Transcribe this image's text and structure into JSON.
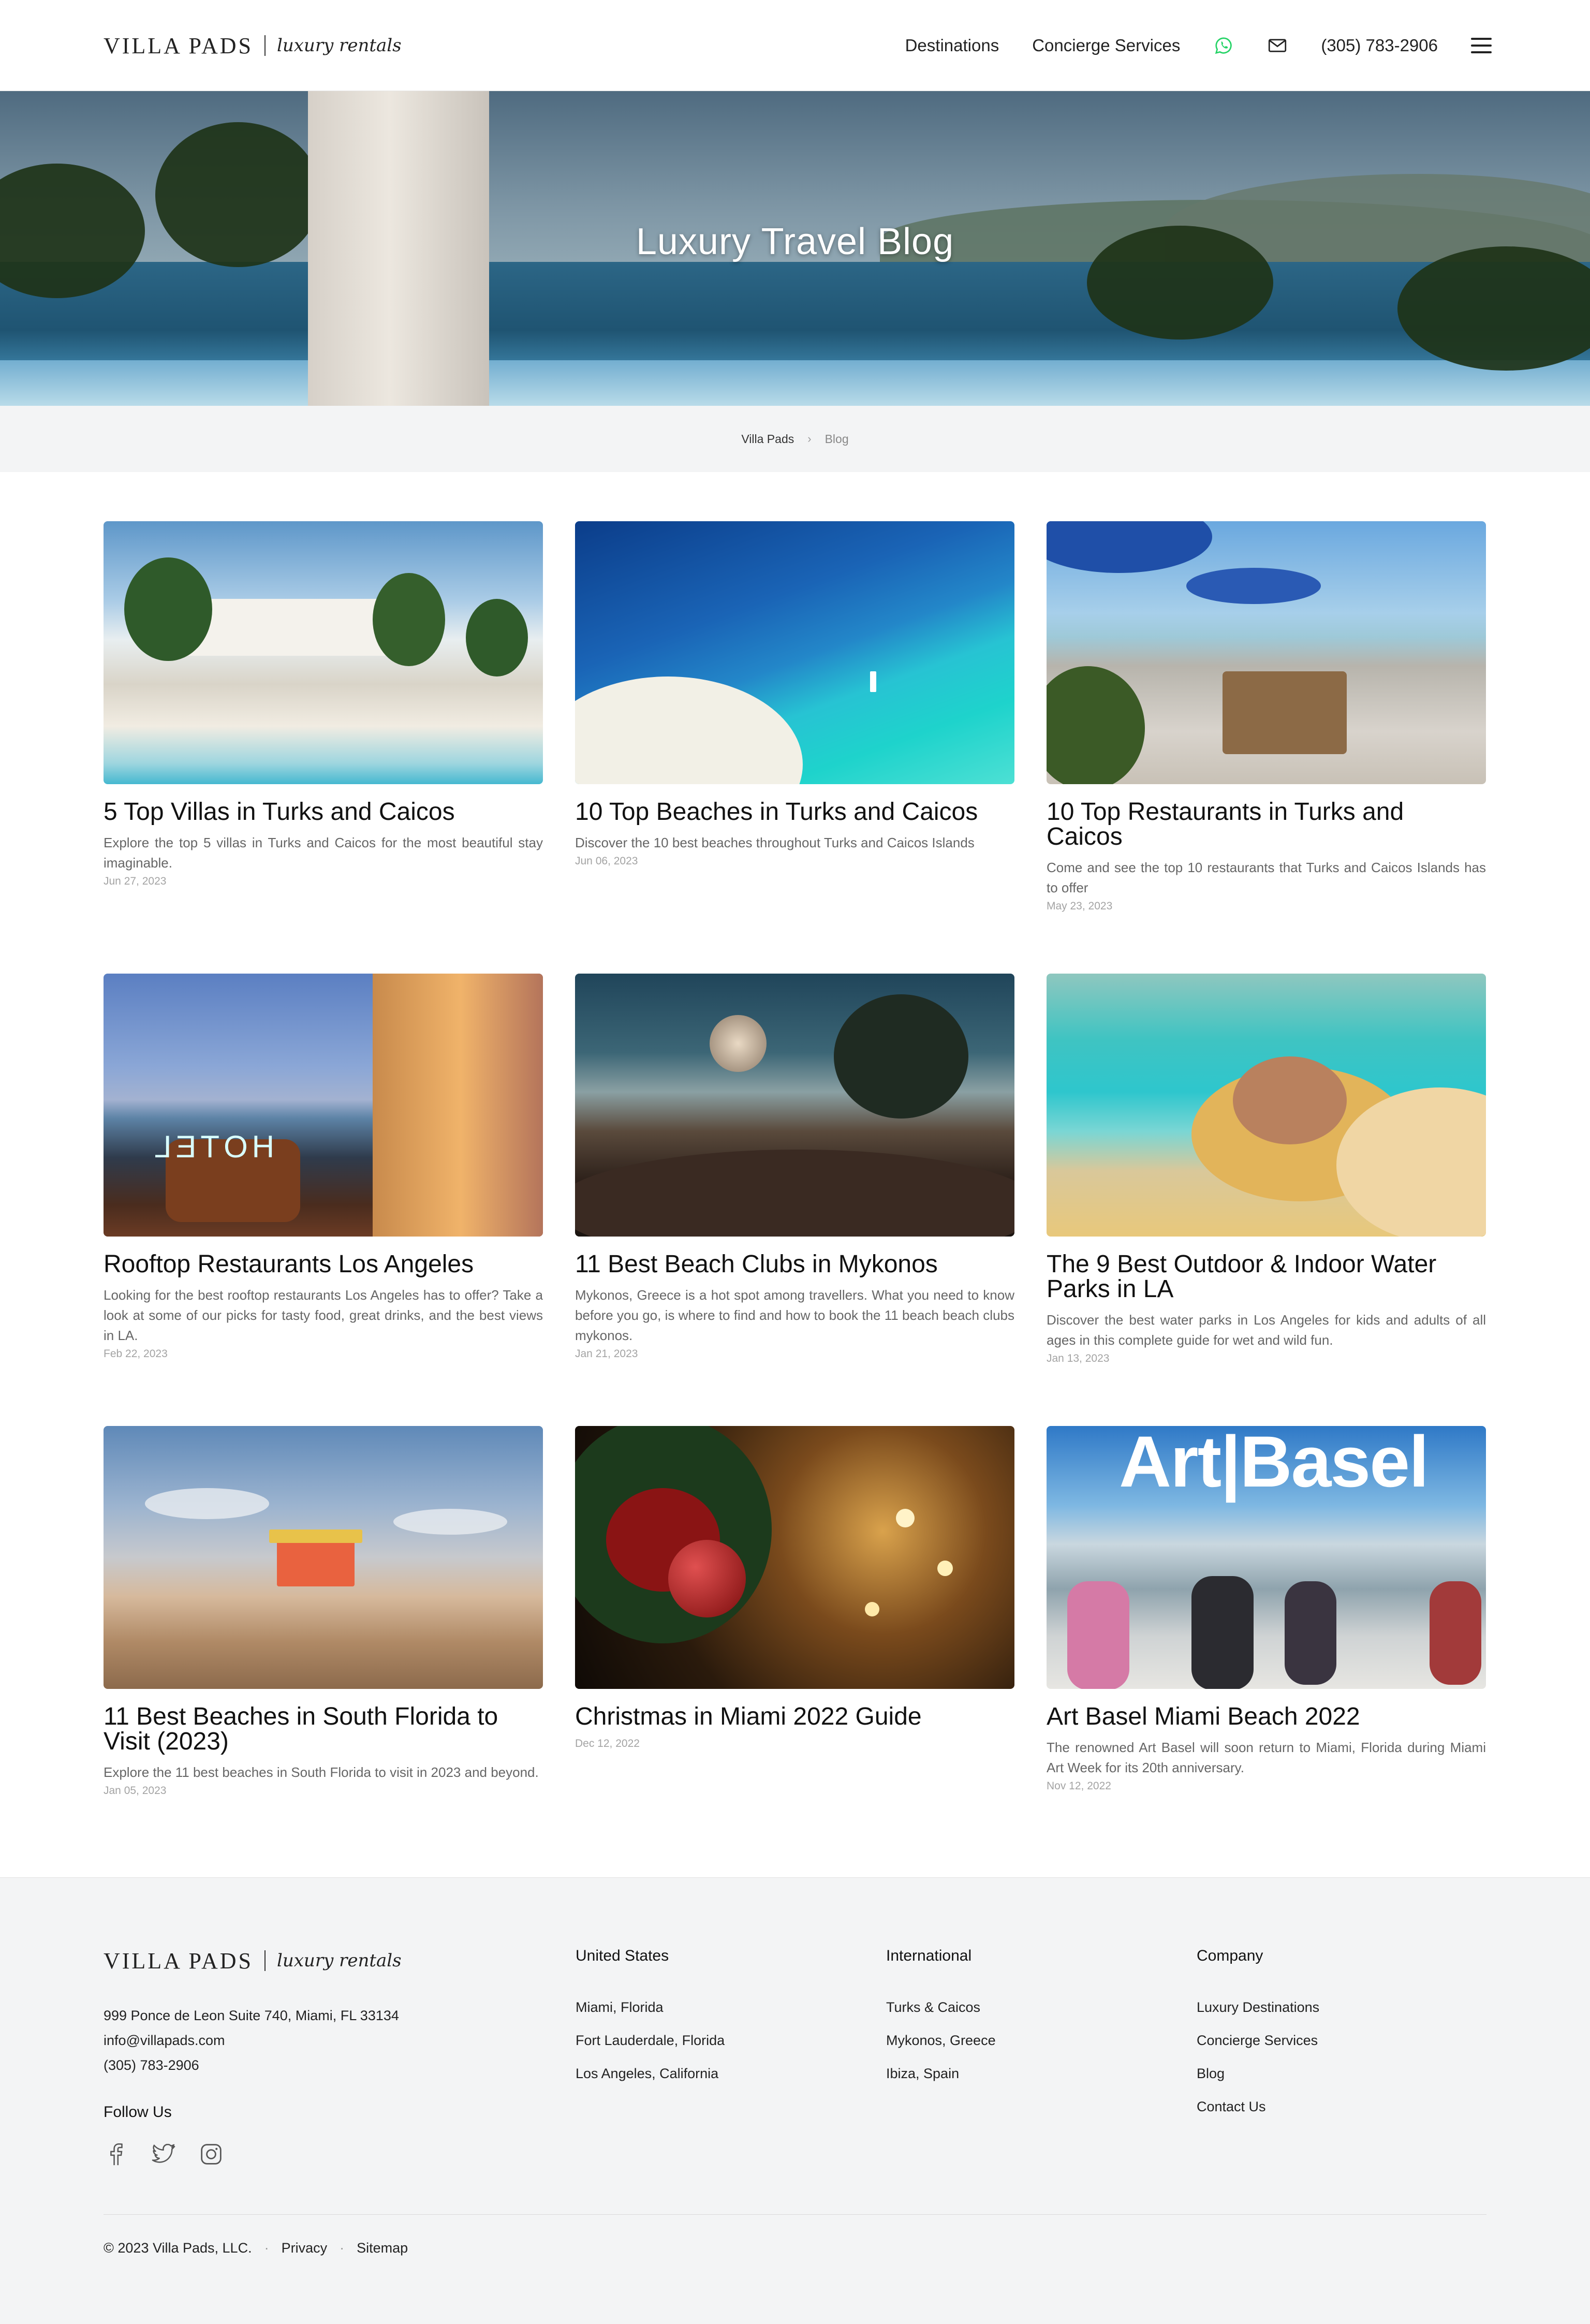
{
  "header": {
    "logo_main": "VILLA PADS",
    "logo_script": "luxury rentals",
    "nav": [
      "Destinations",
      "Concierge Services"
    ],
    "phone": "(305) 783-2906",
    "icons": [
      "whatsapp-icon",
      "mail-icon",
      "menu-icon"
    ]
  },
  "hero": {
    "title": "Luxury Travel Blog"
  },
  "breadcrumb": {
    "home": "Villa Pads",
    "current": "Blog"
  },
  "posts": [
    {
      "title": "5 Top Villas in Turks and Caicos",
      "excerpt": "Explore the top 5 villas in Turks and Caicos for the most beautiful stay imaginable.",
      "date": "Jun 27, 2023"
    },
    {
      "title": "10 Top Beaches in Turks and Caicos",
      "excerpt": "Discover the 10 best beaches throughout Turks and Caicos Islands",
      "date": "Jun 06, 2023"
    },
    {
      "title": "10 Top Restaurants in Turks and Caicos",
      "excerpt": "Come and see the top 10 restaurants that Turks and Caicos Islands has to offer",
      "date": "May 23, 2023"
    },
    {
      "title": "Rooftop Restaurants Los Angeles",
      "excerpt": "Looking for the best rooftop restaurants Los Angeles has to offer? Take a look at some of our picks for tasty food, great drinks, and the best views in LA.",
      "date": "Feb 22, 2023"
    },
    {
      "title": "11 Best Beach Clubs in Mykonos",
      "excerpt": "Mykonos, Greece is a hot spot among travellers. What you need to know before you go, is where to find and how to book the 11 beach beach clubs mykonos.",
      "date": "Jan 21, 2023"
    },
    {
      "title": "The 9 Best Outdoor & Indoor Water Parks in LA",
      "excerpt": "Discover the best water parks in Los Angeles for kids and adults of all ages in this complete guide for wet and wild fun.",
      "date": "Jan 13, 2023"
    },
    {
      "title": "11 Best Beaches in South Florida to Visit (2023)",
      "excerpt": "Explore the 11 best beaches in South Florida to visit in 2023 and beyond.",
      "date": "Jan 05, 2023"
    },
    {
      "title": "Christmas in Miami 2022 Guide",
      "excerpt": "",
      "date": "Dec 12, 2022"
    },
    {
      "title": "Art Basel Miami Beach 2022",
      "excerpt": "The renowned Art Basel will soon return to Miami, Florida during Miami Art Week for its 20th anniversary.",
      "date": "Nov 12, 2022"
    }
  ],
  "images": {
    "rooftop_sign": "HOTEL",
    "basel_sign": "Art|Basel"
  },
  "footer": {
    "logo_main": "VILLA PADS",
    "logo_script": "luxury rentals",
    "address": "999 Ponce de Leon Suite 740, Miami, FL 33134",
    "email": "info@villapads.com",
    "phone": "(305) 783-2906",
    "follow": "Follow Us",
    "social": [
      "facebook-icon",
      "twitter-icon",
      "instagram-icon"
    ],
    "columns": [
      {
        "heading": "United States",
        "links": [
          "Miami, Florida",
          "Fort Lauderdale, Florida",
          "Los Angeles, California"
        ]
      },
      {
        "heading": "International",
        "links": [
          "Turks & Caicos",
          "Mykonos, Greece",
          "Ibiza, Spain"
        ]
      },
      {
        "heading": "Company",
        "links": [
          "Luxury Destinations",
          "Concierge Services",
          "Blog",
          "Contact Us"
        ]
      }
    ],
    "copyright": "© 2023 Villa Pads, LLC.",
    "bottom_links": [
      "Privacy",
      "Sitemap"
    ]
  },
  "colors": {
    "whatsapp": "#25D366",
    "footer_bg": "#f3f4f5",
    "breadcrumb_bg": "#f3f4f5"
  }
}
